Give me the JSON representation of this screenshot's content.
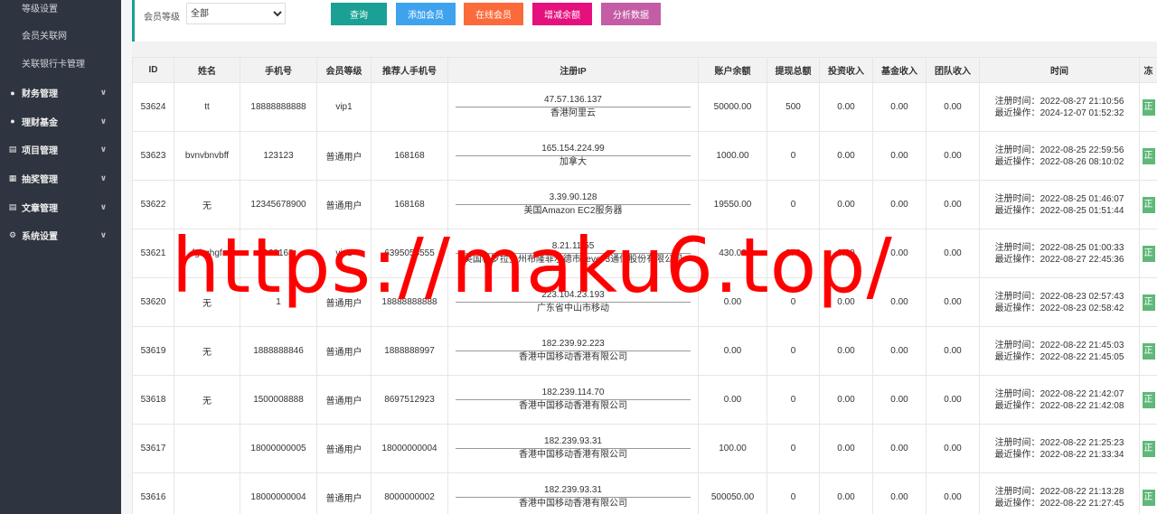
{
  "sidebar": {
    "sub_items": [
      "等级设置",
      "会员关联网",
      "关联银行卡管理"
    ],
    "menus": [
      {
        "label": "财务管理",
        "icon": "●"
      },
      {
        "label": "理财基金",
        "icon": "●"
      },
      {
        "label": "项目管理",
        "icon": "▤"
      },
      {
        "label": "抽奖管理",
        "icon": "▦"
      },
      {
        "label": "文章管理",
        "icon": "▤"
      },
      {
        "label": "系统设置",
        "icon": "⚙"
      }
    ]
  },
  "filter": {
    "level_label": "会员等级",
    "level_selected": "全部"
  },
  "buttons": {
    "query": {
      "label": "查询",
      "color": "#1aa094"
    },
    "add": {
      "label": "添加会员",
      "color": "#3fa2ee"
    },
    "online": {
      "label": "在线会员",
      "color": "#fb6a3b"
    },
    "balance": {
      "label": "增减余额",
      "color": "#e5107e"
    },
    "analysis": {
      "label": "分析数据",
      "color": "#c45da5"
    }
  },
  "table": {
    "headers": [
      "ID",
      "姓名",
      "手机号",
      "会员等级",
      "推荐人手机号",
      "注册IP",
      "账户余额",
      "提现总额",
      "投资收入",
      "基金收入",
      "团队收入",
      "时间",
      "冻"
    ],
    "reg_prefix": "注册时间：",
    "op_prefix": "最近操作：",
    "status_label": "正",
    "rows": [
      {
        "id": "53624",
        "name": "tt",
        "phone": "18888888888",
        "level": "vip1",
        "ref": "",
        "ip": "47.57.136.137",
        "loc": "香港阿里云",
        "balance": "50000.00",
        "withdraw": "500",
        "invest": "0.00",
        "fund": "0.00",
        "team": "0.00",
        "reg": "2022-08-27 21:10:56",
        "op": "2024-12-07 01:52:32"
      },
      {
        "id": "53623",
        "name": "bvnvbnvbff",
        "phone": "123123",
        "level": "普通用户",
        "ref": "168168",
        "ip": "165.154.224.99",
        "loc": "加拿大",
        "balance": "1000.00",
        "withdraw": "0",
        "invest": "0.00",
        "fund": "0.00",
        "team": "0.00",
        "reg": "2022-08-25 22:59:56",
        "op": "2022-08-26 08:10:02"
      },
      {
        "id": "53622",
        "name": "无",
        "phone": "12345678900",
        "level": "普通用户",
        "ref": "168168",
        "ip": "3.39.90.128",
        "loc": "美国Amazon EC2服务器",
        "balance": "19550.00",
        "withdraw": "0",
        "invest": "0.00",
        "fund": "0.00",
        "team": "0.00",
        "reg": "2022-08-25 01:46:07",
        "op": "2022-08-25 01:51:44"
      },
      {
        "id": "53621",
        "name": "fghghgf",
        "phone": "168168",
        "level": "vip1",
        "ref": "6395055555",
        "ip": "8.21.11.55",
        "loc": "美国科罗拉多州布隆菲尔德市Level 3通信股份有限公司",
        "balance": "430.00",
        "withdraw": "270",
        "invest": "0.00",
        "fund": "0.00",
        "team": "0.00",
        "reg": "2022-08-25 01:00:33",
        "op": "2022-08-27 22:45:36"
      },
      {
        "id": "53620",
        "name": "无",
        "phone": "1",
        "level": "普通用户",
        "ref": "18888888888",
        "ip": "223.104.23.193",
        "loc": "广东省中山市移动",
        "balance": "0.00",
        "withdraw": "0",
        "invest": "0.00",
        "fund": "0.00",
        "team": "0.00",
        "reg": "2022-08-23 02:57:43",
        "op": "2022-08-23 02:58:42"
      },
      {
        "id": "53619",
        "name": "无",
        "phone": "1888888846",
        "level": "普通用户",
        "ref": "1888888997",
        "ip": "182.239.92.223",
        "loc": "香港中国移动香港有限公司",
        "balance": "0.00",
        "withdraw": "0",
        "invest": "0.00",
        "fund": "0.00",
        "team": "0.00",
        "reg": "2022-08-22 21:45:03",
        "op": "2022-08-22 21:45:05"
      },
      {
        "id": "53618",
        "name": "无",
        "phone": "1500008888",
        "level": "普通用户",
        "ref": "8697512923",
        "ip": "182.239.114.70",
        "loc": "香港中国移动香港有限公司",
        "balance": "0.00",
        "withdraw": "0",
        "invest": "0.00",
        "fund": "0.00",
        "team": "0.00",
        "reg": "2022-08-22 21:42:07",
        "op": "2022-08-22 21:42:08"
      },
      {
        "id": "53617",
        "name": "",
        "phone": "18000000005",
        "level": "普通用户",
        "ref": "18000000004",
        "ip": "182.239.93.31",
        "loc": "香港中国移动香港有限公司",
        "balance": "100.00",
        "withdraw": "0",
        "invest": "0.00",
        "fund": "0.00",
        "team": "0.00",
        "reg": "2022-08-22 21:25:23",
        "op": "2022-08-22 21:33:34"
      },
      {
        "id": "53616",
        "name": "",
        "phone": "18000000004",
        "level": "普通用户",
        "ref": "8000000002",
        "ip": "182.239.93.31",
        "loc": "香港中国移动香港有限公司",
        "balance": "500050.00",
        "withdraw": "0",
        "invest": "0.00",
        "fund": "0.00",
        "team": "0.00",
        "reg": "2022-08-22 21:13:28",
        "op": "2022-08-22 21:27:45"
      }
    ]
  },
  "watermark": "https://maku6.top/"
}
